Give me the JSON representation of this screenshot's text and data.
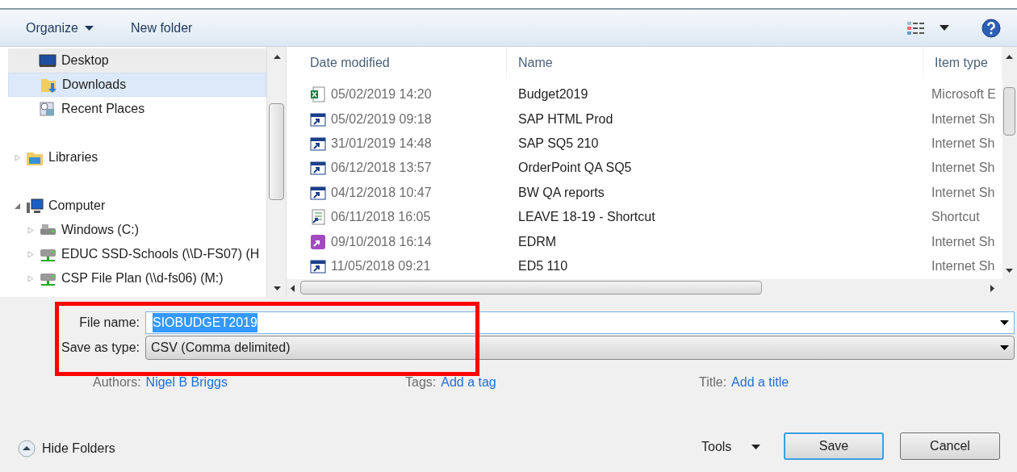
{
  "toolbar": {
    "organize": "Organize",
    "new_folder": "New folder"
  },
  "nav": [
    {
      "label": "Desktop",
      "kind": "desktop",
      "selected": false
    },
    {
      "label": "Downloads",
      "kind": "downloads",
      "selected": true
    },
    {
      "label": "Recent Places",
      "kind": "recent",
      "selected": false
    },
    {
      "label": "Libraries",
      "kind": "libraries",
      "selected": false,
      "expanded": false
    },
    {
      "label": "Computer",
      "kind": "computer",
      "selected": false,
      "expanded": true,
      "children": [
        {
          "label": "Windows (C:)",
          "kind": "drive",
          "selected": false,
          "expanded": false
        },
        {
          "label": "EDUC SSD-Schools (\\\\D-FS07) (H",
          "kind": "network",
          "selected": false,
          "expanded": false
        },
        {
          "label": "CSP File Plan (\\\\d-fs06) (M:)",
          "kind": "network",
          "selected": false,
          "expanded": false
        }
      ]
    }
  ],
  "columns": [
    "Date modified",
    "Name",
    "Item type"
  ],
  "files": [
    {
      "kind": "excel",
      "date": "05/02/2019 14:20",
      "name": "Budget2019",
      "type": "Microsoft E"
    },
    {
      "kind": "url",
      "date": "05/02/2019 09:18",
      "name": "SAP HTML Prod",
      "type": "Internet Sh"
    },
    {
      "kind": "url",
      "date": "31/01/2019 14:48",
      "name": "SAP SQ5 210",
      "type": "Internet Sh"
    },
    {
      "kind": "url",
      "date": "06/12/2018 13:57",
      "name": "OrderPoint QA SQ5",
      "type": "Internet Sh"
    },
    {
      "kind": "url",
      "date": "04/12/2018 10:47",
      "name": "BW QA reports",
      "type": "Internet Sh"
    },
    {
      "kind": "sheet",
      "date": "06/11/2018 16:05",
      "name": "LEAVE 18-19 - Shortcut",
      "type": "Shortcut"
    },
    {
      "kind": "app",
      "date": "09/10/2018 16:14",
      "name": "EDRM",
      "type": "Internet Sh"
    },
    {
      "kind": "url",
      "date": "11/05/2018 09:21",
      "name": "ED5 110",
      "type": "Internet Sh"
    }
  ],
  "file_name": {
    "label": "File name:",
    "value": "SIOBUDGET2019"
  },
  "save_as_type": {
    "label": "Save as type:",
    "value": "CSV (Comma delimited)"
  },
  "meta": [
    {
      "label": "Authors:",
      "value": "Nigel B Briggs"
    },
    {
      "label": "Tags:",
      "value": "Add a tag"
    },
    {
      "label": "Title:",
      "value": "Add a title"
    }
  ],
  "hide_folders": "Hide Folders",
  "tools": "Tools",
  "buttons": {
    "save": "Save",
    "cancel": "Cancel"
  }
}
